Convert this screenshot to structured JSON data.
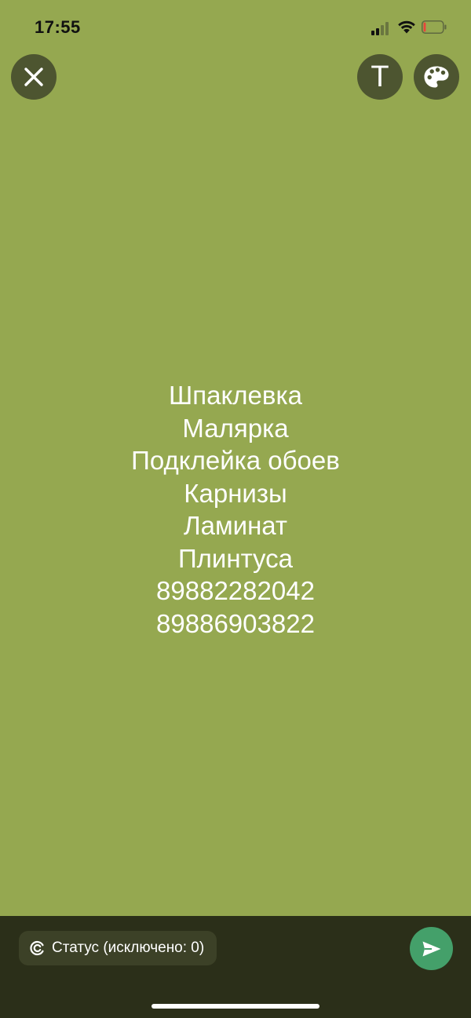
{
  "status_bar": {
    "time": "17:55",
    "signal_icon": "cellular-signal-icon",
    "wifi_icon": "wifi-icon",
    "battery_icon": "battery-low-icon",
    "battery_level": 0.12
  },
  "toolbar": {
    "close_icon": "close-icon",
    "text_button_label": "T",
    "palette_icon": "palette-icon"
  },
  "status_text": {
    "lines": [
      "Шпаклевка",
      "Малярка",
      "Подклейка обоев",
      "Карнизы",
      "Ламинат",
      "Плинтуса",
      "89882282042",
      "89886903822"
    ]
  },
  "footer": {
    "privacy_icon": "privacy-ring-icon",
    "privacy_label": "Статус (исключено: 0)",
    "send_icon": "send-icon"
  },
  "colors": {
    "background": "#95a850",
    "button_bg": "#4d5530",
    "bottom_bar": "#2b2f19",
    "pill_bg": "#3c4127",
    "send_button": "#44a06a",
    "battery_low": "#e8453c"
  }
}
